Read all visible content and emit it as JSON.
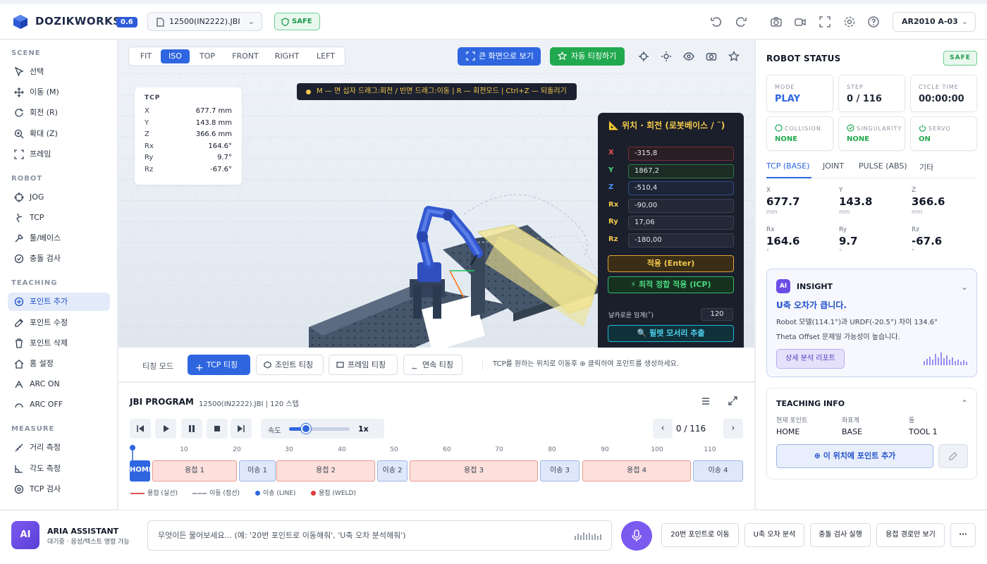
{
  "header": {
    "brand": "DOZIKWORKS",
    "version_badge": "0.6",
    "file_name": "12500(IN2222).JBI",
    "safe_label": "SAFE",
    "robot_model": "AR2010 A-03",
    "icons": [
      "undo-icon",
      "redo-icon",
      "camera-icon",
      "video-icon",
      "fullscreen-icon",
      "gear-icon",
      "help-icon"
    ]
  },
  "sidebar": {
    "sections": [
      {
        "title": "SCENE",
        "items": [
          {
            "label": "선택",
            "icon": "cursor-icon"
          },
          {
            "label": "이동 (M)",
            "icon": "move-icon"
          },
          {
            "label": "회전 (R)",
            "icon": "rotate-icon"
          },
          {
            "label": "확대 (Z)",
            "icon": "zoom-icon"
          },
          {
            "label": "프레임",
            "icon": "frame-icon"
          }
        ]
      },
      {
        "title": "ROBOT",
        "items": [
          {
            "label": "JOG",
            "icon": "crosshair-icon"
          },
          {
            "label": "TCP",
            "icon": "tcp-icon"
          },
          {
            "label": "툴/베이스",
            "icon": "wrench-icon"
          },
          {
            "label": "충돌 검사",
            "icon": "check-circle-icon"
          }
        ]
      },
      {
        "title": "TEACHING",
        "items": [
          {
            "label": "포인트 추가",
            "icon": "plus-circle-icon",
            "active": true
          },
          {
            "label": "포인트 수정",
            "icon": "edit-icon"
          },
          {
            "label": "포인트 삭제",
            "icon": "trash-icon"
          },
          {
            "label": "홈 설정",
            "icon": "home-icon"
          },
          {
            "label": "ARC ON",
            "icon": "arc-on-icon"
          },
          {
            "label": "ARC OFF",
            "icon": "arc-off-icon"
          }
        ]
      },
      {
        "title": "MEASURE",
        "items": [
          {
            "label": "거리 측정",
            "icon": "ruler-icon"
          },
          {
            "label": "각도 측정",
            "icon": "angle-icon"
          },
          {
            "label": "TCP 검사",
            "icon": "target-icon"
          }
        ]
      }
    ]
  },
  "toolbar": {
    "views": [
      "FIT",
      "ISO",
      "TOP",
      "FRONT",
      "RIGHT",
      "LEFT"
    ],
    "active_view": "ISO",
    "big_view_label": "큰 화면으로 보기",
    "auto_teach_label": "자동 티칭하기"
  },
  "viewport": {
    "hint": "M — 면 십자 드래그:회전 / 빈면 드래그:이동 | R — 회전모드 | Ctrl+Z — 되돌리기",
    "tcp_card": {
      "title": "TCP",
      "rows": [
        {
          "k": "X",
          "v": "677.7 mm"
        },
        {
          "k": "Y",
          "v": "143.8 mm"
        },
        {
          "k": "Z",
          "v": "366.6 mm"
        },
        {
          "k": "Rx",
          "v": "164.6°"
        },
        {
          "k": "Ry",
          "v": "9.7°"
        },
        {
          "k": "Rz",
          "v": "-67.6°"
        }
      ]
    },
    "pos_panel": {
      "title": "위치 · 회전 (로봇베이스 / ¨)",
      "rows": [
        {
          "k": "X",
          "v": "-315,8",
          "color": "#f05252"
        },
        {
          "k": "Y",
          "v": "1867,2",
          "color": "#4ad67f"
        },
        {
          "k": "Z",
          "v": "-510,4",
          "color": "#4f8ff7"
        },
        {
          "k": "Rx",
          "v": "-90,00",
          "color": "#f3c84a"
        },
        {
          "k": "Ry",
          "v": "17,06",
          "color": "#f3c84a"
        },
        {
          "k": "Rz",
          "v": "-180,00",
          "color": "#f3c84a"
        }
      ],
      "apply_label": "적용 (Enter)",
      "icp_label": "최적 정합 적용 (ICP)",
      "sharp_label": "날카로운 임계(˚)",
      "sharp_value": "120",
      "edge_label": "필렛 모서리 추출"
    }
  },
  "teach_bar": {
    "mode_label": "티칭 모드",
    "buttons": [
      {
        "label": "TCP 티칭",
        "active": true
      },
      {
        "label": "조인트 티칭"
      },
      {
        "label": "프레임 티칭"
      },
      {
        "label": "연속 티칭"
      }
    ],
    "help": "TCP를 원하는 위치로 이동후 ⊕ 클릭하여 포인트를 생성하세요."
  },
  "program": {
    "title": "JBI PROGRAM",
    "subtitle": "12500(IN2222).JBI | 120 스텝",
    "speed_label": "속도",
    "speed_value": "1x",
    "speed_fraction": 0.28,
    "step": "0 / 116",
    "ticks": [
      "10",
      "20",
      "30",
      "40",
      "50",
      "60",
      "70",
      "80",
      "90",
      "100",
      "110"
    ],
    "segments": [
      {
        "label": "HOME",
        "kind": "home"
      },
      {
        "label": "용접 1",
        "kind": "weld"
      },
      {
        "label": "이송 1",
        "kind": "move"
      },
      {
        "label": "용접 2",
        "kind": "weld"
      },
      {
        "label": "이송 2",
        "kind": "move"
      },
      {
        "label": "용접 3",
        "kind": "weld"
      },
      {
        "label": "이송 3",
        "kind": "move"
      },
      {
        "label": "용접 4",
        "kind": "weld"
      },
      {
        "label": "이송 4",
        "kind": "move"
      }
    ],
    "legend": [
      "용접 (실선)",
      "이동 (점선)",
      "이송 (LINE)",
      "용접 (WELD)"
    ]
  },
  "right": {
    "title": "ROBOT STATUS",
    "safe_label": "SAFE",
    "cards": [
      {
        "label": "MODE",
        "value": "PLAY"
      },
      {
        "label": "STEP",
        "value": "0 / 116"
      },
      {
        "label": "CYCLE TIME",
        "value": "00:00:00"
      }
    ],
    "checks": [
      {
        "label": "COLLISION",
        "value": "NONE"
      },
      {
        "label": "SINGULARITY",
        "value": "NONE"
      },
      {
        "label": "SERVO",
        "value": "ON"
      }
    ],
    "tabs": [
      "TCP (BASE)",
      "JOINT",
      "PULSE (ABS)",
      "기타"
    ],
    "coords": [
      {
        "k": "X",
        "v": "677.7",
        "u": "mm"
      },
      {
        "k": "Y",
        "v": "143.8",
        "u": "mm"
      },
      {
        "k": "Z",
        "v": "366.6",
        "u": "mm"
      },
      {
        "k": "Rx",
        "v": "164.6",
        "u": "°"
      },
      {
        "k": "Ry",
        "v": "9.7",
        "u": "°"
      },
      {
        "k": "Rz",
        "v": "-67.6",
        "u": "°"
      }
    ],
    "insight": {
      "badge": "AI",
      "title": "INSIGHT",
      "headline": "U축 오차가 큽니다.",
      "line1": "Robot 모델(114.1°)과 URDF(-20.5°) 차이 134.6°",
      "line2": "Theta Offset 문제일 가능성이 높습니다.",
      "report_label": "상세 분석 리포트"
    },
    "teaching_info": {
      "title": "TEACHING INFO",
      "cols": [
        {
          "k": "현재 포인트",
          "v": "HOME"
        },
        {
          "k": "좌표계",
          "v": "BASE"
        },
        {
          "k": "툴",
          "v": "TOOL 1"
        }
      ],
      "add_label": "이 위치에 포인트 추가"
    }
  },
  "bottom": {
    "ai_badge": "AI",
    "name": "ARIA ASSISTANT",
    "status": "대기중 · 음성/텍스트 명령 가능",
    "placeholder": "무엇이든 물어보세요... (예: '20번 포인트로 이동해줘', 'U축 오차 분석해줘')",
    "quick": [
      "20번 포인트로 이동",
      "U축 오차 분석",
      "충돌 검사 실행",
      "용접 경로만 보기"
    ]
  }
}
